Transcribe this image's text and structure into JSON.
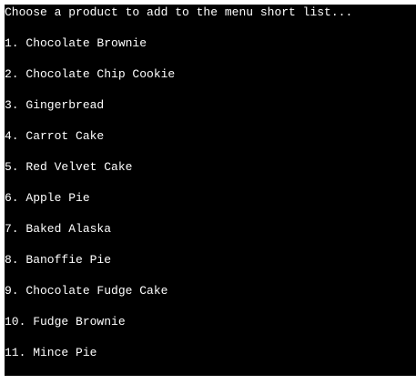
{
  "console": {
    "prompt": "Choose a product to add to the menu short list...",
    "items": [
      "1. Chocolate Brownie",
      "2. Chocolate Chip Cookie",
      "3. Gingerbread",
      "4. Carrot Cake",
      "5. Red Velvet Cake",
      "6. Apple Pie",
      "7. Baked Alaska",
      "8. Banoffie Pie",
      "9. Chocolate Fudge Cake",
      "10. Fudge Brownie",
      "11. Mince Pie"
    ]
  },
  "colors": {
    "background": "#000000",
    "text": "#ffffff",
    "page": "#ffffff"
  }
}
